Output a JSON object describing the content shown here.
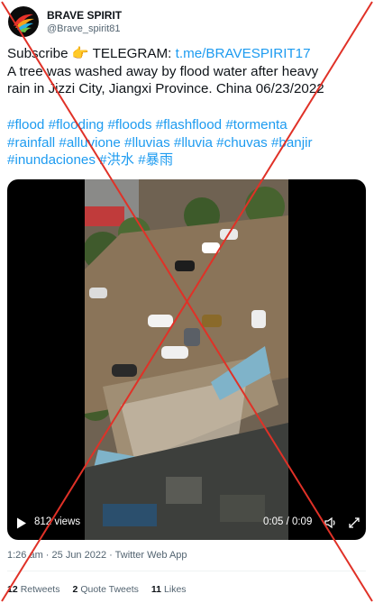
{
  "account": {
    "display_name": "BRAVE SPIRIT",
    "handle": "@Brave_spirit81"
  },
  "tweet": {
    "line1_prefix": "Subscribe ",
    "pointer_emoji": "👉",
    "line1_middle": " TELEGRAM: ",
    "telegram_link": "t.me/BRAVESPIRIT17",
    "line2": "A tree was washed away by flood water after heavy",
    "line3": "rain in Jizzi City, Jiangxi Province. China 06/23/2022",
    "hashtags_line1": "#flood #flooding #floods #flashflood #tormenta",
    "hashtags_line2": "#rainfall #alluvione #lluvias #lluvia #chuvas #banjir",
    "hashtags_line3": "#inundaciones #洪水 #暴雨"
  },
  "video": {
    "views": "812 views",
    "time": "0:05 / 0:09",
    "play_icon": "play-icon",
    "volume_icon": "volume-icon",
    "fullscreen_icon": "fullscreen-icon"
  },
  "meta": {
    "posted": "1:26 am · 25 Jun 2022 · Twitter Web App"
  },
  "stats": [
    {
      "count": "12",
      "label": "Retweets"
    },
    {
      "count": "2",
      "label": "Quote Tweets"
    },
    {
      "count": "11",
      "label": "Likes"
    }
  ],
  "colors": {
    "link": "#1d9bf0",
    "text": "#0f1419",
    "muted": "#536471",
    "cross": "#e03127"
  }
}
